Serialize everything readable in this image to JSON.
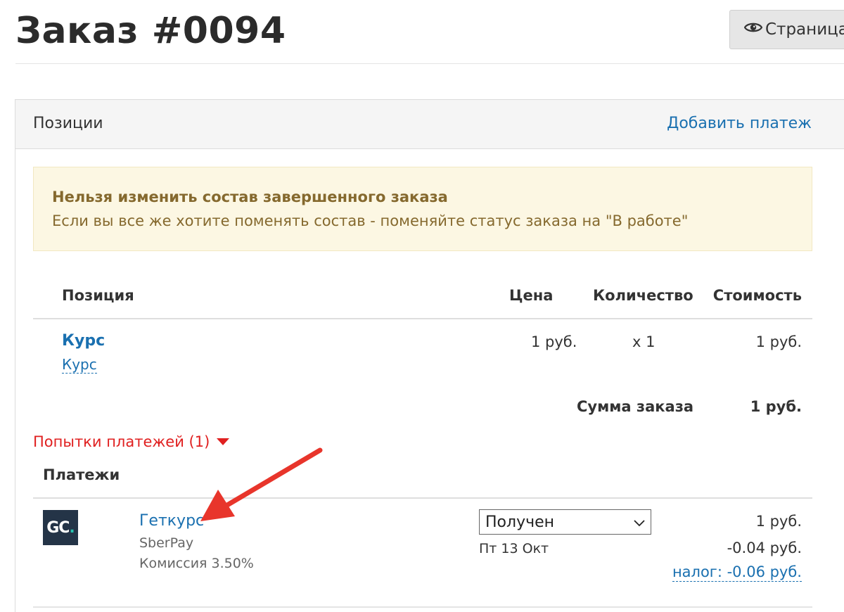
{
  "header": {
    "title": "Заказ #0094",
    "view_button_label": "Страница"
  },
  "panel": {
    "title": "Позиции",
    "add_payment_label": "Добавить платеж"
  },
  "alert": {
    "title": "Нельзя изменить состав завершенного заказа",
    "text": "Если вы все же хотите поменять состав - поменяйте статус заказа на \"В работе\""
  },
  "table": {
    "headers": [
      "Позиция",
      "Цена",
      "Количество",
      "Стоимость"
    ],
    "rows": [
      {
        "name": "Курс",
        "subname": "Курс",
        "price": "1 руб.",
        "quantity": "x 1",
        "cost": "1 руб."
      }
    ],
    "total_label": "Сумма заказа",
    "total_value": "1 руб."
  },
  "attempts": {
    "label": "Попытки платежей (1)"
  },
  "payments": {
    "heading": "Платежи",
    "items": [
      {
        "logo_text": "GC",
        "logo_accent": ".",
        "name": "Геткурс",
        "method": "SberPay",
        "commission": "Комиссия 3.50%",
        "status": "Получен",
        "date": "Пт 13 Окт",
        "amount": "1 руб.",
        "fee": "-0.04 руб.",
        "tax": "налог: -0.06 руб."
      }
    ]
  },
  "colors": {
    "link": "#1a70b0",
    "alert_text": "#85692e",
    "alert_bg": "#fcf7e3",
    "attempts_red": "#e02020",
    "annotation_arrow": "#e8352b",
    "logo_bg": "#243447",
    "logo_accent": "#26c3b0"
  },
  "icons": {
    "view_button": "eye-icon",
    "attempts_toggle": "caret-down-icon",
    "status_select": "chevron-down-icon",
    "annotation": "red-arrow-annotation"
  }
}
